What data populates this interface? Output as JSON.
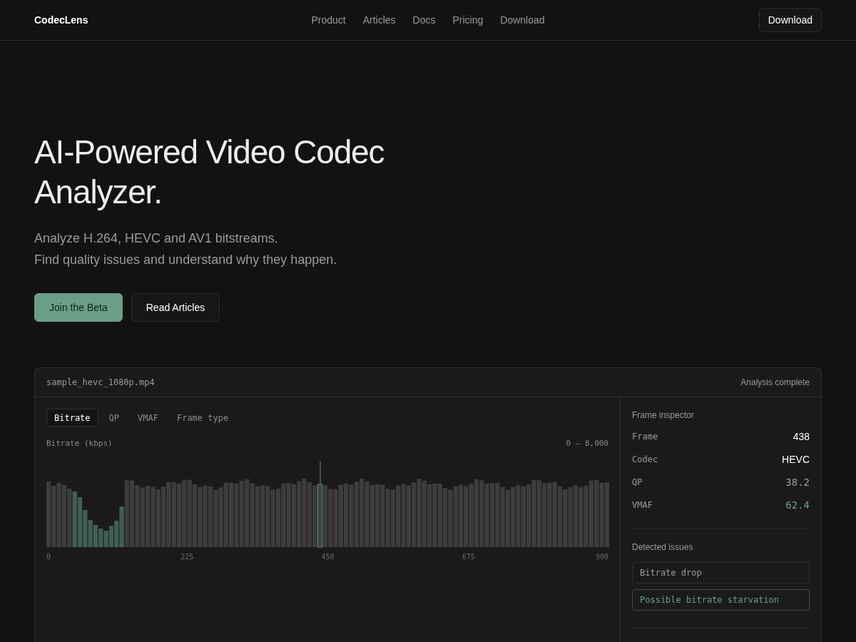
{
  "nav": {
    "logo": "CodecLens",
    "links": [
      "Product",
      "Articles",
      "Docs",
      "Pricing",
      "Download"
    ],
    "button": "Download"
  },
  "hero": {
    "title": "AI-Powered Video Codec Analyzer.",
    "subtitle_lines": [
      "Analyze H.264, HEVC and AV1 bitstreams.",
      "Find quality issues and understand why they happen."
    ],
    "buttons": [
      {
        "label": "Join the Beta",
        "kind": "primary"
      },
      {
        "label": "Read Articles",
        "kind": "secondary"
      }
    ]
  },
  "analyzer": {
    "file": "sample_hevc_1080p.mp4",
    "status": "Analysis complete",
    "tabs": [
      {
        "label": "Bitrate",
        "selected": true
      },
      {
        "label": "QP",
        "selected": false
      },
      {
        "label": "VMAF",
        "selected": false
      },
      {
        "label": "Frame type",
        "selected": false
      }
    ],
    "chart_label": "Bitrate (kbps)",
    "chart_range": "0 – 8,000",
    "x_labels": [
      "0",
      "225",
      "450",
      "675",
      "900"
    ],
    "inspector": {
      "title": "Frame inspector",
      "rows": [
        {
          "label": "Frame",
          "value": "438",
          "kind": "strong"
        },
        {
          "label": "Codec",
          "value": "HEVC",
          "kind": "strong"
        },
        {
          "label": "QP",
          "value": "38.2",
          "kind": "muted"
        },
        {
          "label": "VMAF",
          "value": "62.4",
          "kind": "accent"
        }
      ],
      "issues_title": "Detected issues",
      "issues": [
        {
          "label": "Bitrate drop",
          "kind": "plain"
        },
        {
          "label": "Possible bitrate starvation",
          "kind": "accent"
        }
      ]
    }
  }
}
